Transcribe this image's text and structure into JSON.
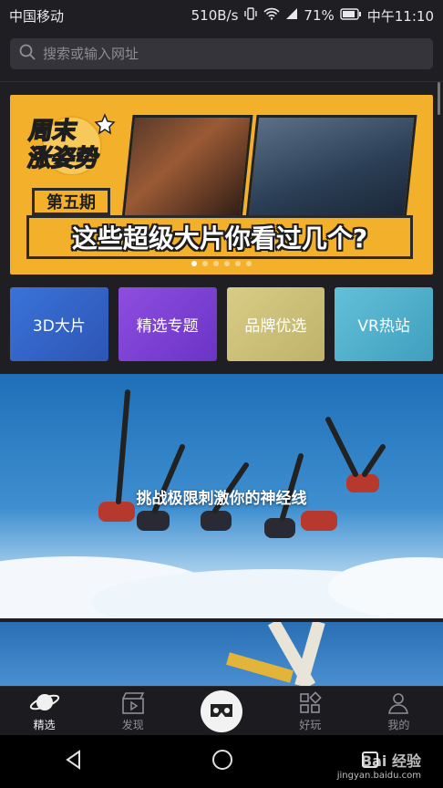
{
  "status_bar": {
    "carrier": "中国移动",
    "speed": "510B/s",
    "battery": "71%",
    "time": "中午11:10"
  },
  "search": {
    "placeholder": "搜索或输入网址"
  },
  "banner": {
    "logo_line1": "周末",
    "logo_line2": "涨姿势",
    "issue": "第五期",
    "headline": "这些超级大片你看过几个?",
    "dots_count": 6,
    "active_dot": 0
  },
  "categories": [
    {
      "label": "3D大片"
    },
    {
      "label": "精选专题"
    },
    {
      "label": "品牌优选"
    },
    {
      "label": "VR热站"
    }
  ],
  "feature": {
    "title": "挑战极限刺激你的神经线"
  },
  "tabs": [
    {
      "label": "精选",
      "icon": "planet-icon"
    },
    {
      "label": "发现",
      "icon": "clapperboard-icon"
    },
    {
      "label": "",
      "icon": "vr-glasses-icon"
    },
    {
      "label": "好玩",
      "icon": "apps-grid-icon"
    },
    {
      "label": "我的",
      "icon": "person-icon"
    }
  ],
  "watermark": {
    "line1": "Bai 经验",
    "line2": "jingyan.baidu.com"
  },
  "colors": {
    "banner_yellow": "#f3b02a",
    "background": "#1f1f23"
  }
}
